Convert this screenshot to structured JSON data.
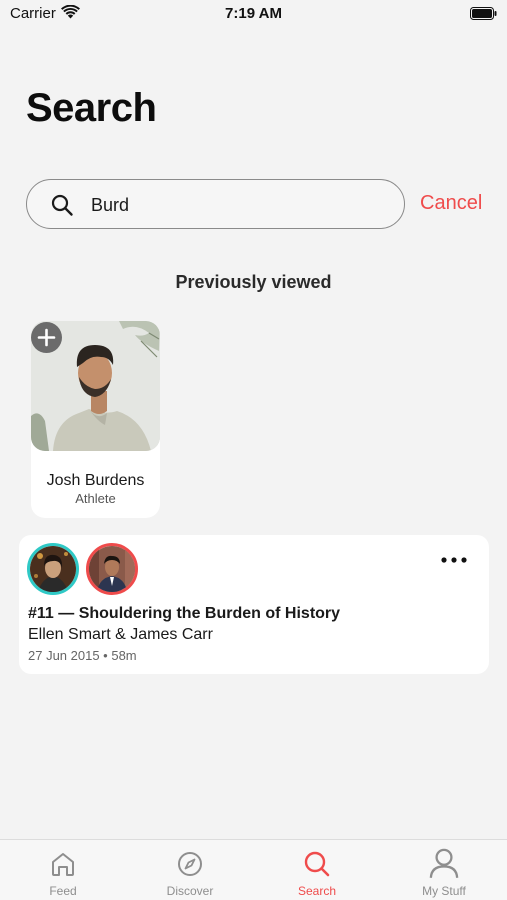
{
  "status_bar": {
    "carrier": "Carrier",
    "time": "7:19 AM"
  },
  "header": {
    "title": "Search"
  },
  "search": {
    "value": "Burd",
    "cancel_label": "Cancel"
  },
  "previously_viewed": {
    "heading": "Previously viewed",
    "items": [
      {
        "name": "Josh Burdens",
        "role": "Athlete"
      }
    ]
  },
  "episodes": [
    {
      "title": "#11 — Shouldering the Burden of History",
      "authors": "Ellen Smart & James Carr",
      "meta": "27 Jun 2015 • 58m"
    }
  ],
  "tab_bar": {
    "tabs": [
      {
        "label": "Feed",
        "icon": "home-icon",
        "active": false
      },
      {
        "label": "Discover",
        "icon": "compass-icon",
        "active": false
      },
      {
        "label": "Search",
        "icon": "search-icon",
        "active": true
      },
      {
        "label": "My Stuff",
        "icon": "person-icon",
        "active": false
      }
    ]
  },
  "colors": {
    "accent": "#ef4b4b",
    "teal": "#2fc9c6",
    "background": "#f3f3f3"
  }
}
